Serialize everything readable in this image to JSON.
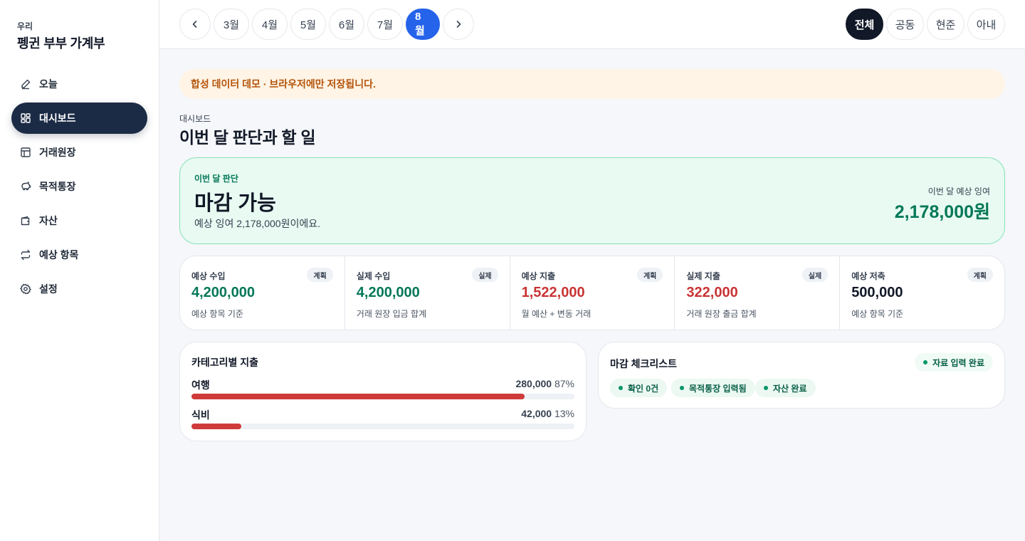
{
  "brand": {
    "sub": "우리",
    "title": "펭귄 부부 가계부"
  },
  "sidebar": {
    "items": [
      {
        "label": "오늘",
        "icon": "pencil-icon"
      },
      {
        "label": "대시보드",
        "icon": "dashboard-icon",
        "active": true
      },
      {
        "label": "거래원장",
        "icon": "ledger-icon"
      },
      {
        "label": "목적통장",
        "icon": "piggy-bank-icon"
      },
      {
        "label": "자산",
        "icon": "wallet-icon"
      },
      {
        "label": "예상 항목",
        "icon": "repeat-icon"
      },
      {
        "label": "설정",
        "icon": "gear-icon"
      }
    ]
  },
  "topbar": {
    "months": [
      "3월",
      "4월",
      "5월",
      "6월",
      "7월",
      "8월"
    ],
    "selected_month": "8월",
    "scopes": [
      "전체",
      "공동",
      "현준",
      "아내"
    ],
    "selected_scope": "전체"
  },
  "notice": "합성 데이터 데모 · 브라우저에만 저장됩니다.",
  "page": {
    "eyebrow": "대시보드",
    "title": "이번 달 판단과 할 일"
  },
  "verdict": {
    "label": "이번 달 판단",
    "status": "마감 가능",
    "description": "예상 잉여 2,178,000원이에요.",
    "right_label": "이번 달 예상 잉여",
    "right_value": "2,178,000원"
  },
  "stats": [
    {
      "label": "예상 수입",
      "badge": "계획",
      "value": "4,200,000",
      "note": "예상 항목 기준",
      "color": "#047857"
    },
    {
      "label": "실제 수입",
      "badge": "실제",
      "value": "4,200,000",
      "note": "거래 원장 입금 합계",
      "color": "#047857"
    },
    {
      "label": "예상 지출",
      "badge": "계획",
      "value": "1,522,000",
      "note": "월 예산 + 변동 거래",
      "color": "#c93434"
    },
    {
      "label": "실제 지출",
      "badge": "실제",
      "value": "322,000",
      "note": "거래 원장 출금 합계",
      "color": "#c93434"
    },
    {
      "label": "예상 저축",
      "badge": "계획",
      "value": "500,000",
      "note": "예상 항목 기준",
      "color": "#111827"
    }
  ],
  "categories": {
    "title": "카테고리별 지출",
    "items": [
      {
        "name": "여행",
        "amount": "280,000",
        "percent_label": "87%",
        "percent": 87
      },
      {
        "name": "식비",
        "amount": "42,000",
        "percent_label": "13%",
        "percent": 13
      }
    ]
  },
  "checklist": {
    "title": "마감 체크리스트",
    "status_chip": "자료 입력 완료",
    "chips": [
      "확인 0건",
      "목적통장 입력됨",
      "자산 완료"
    ]
  }
}
